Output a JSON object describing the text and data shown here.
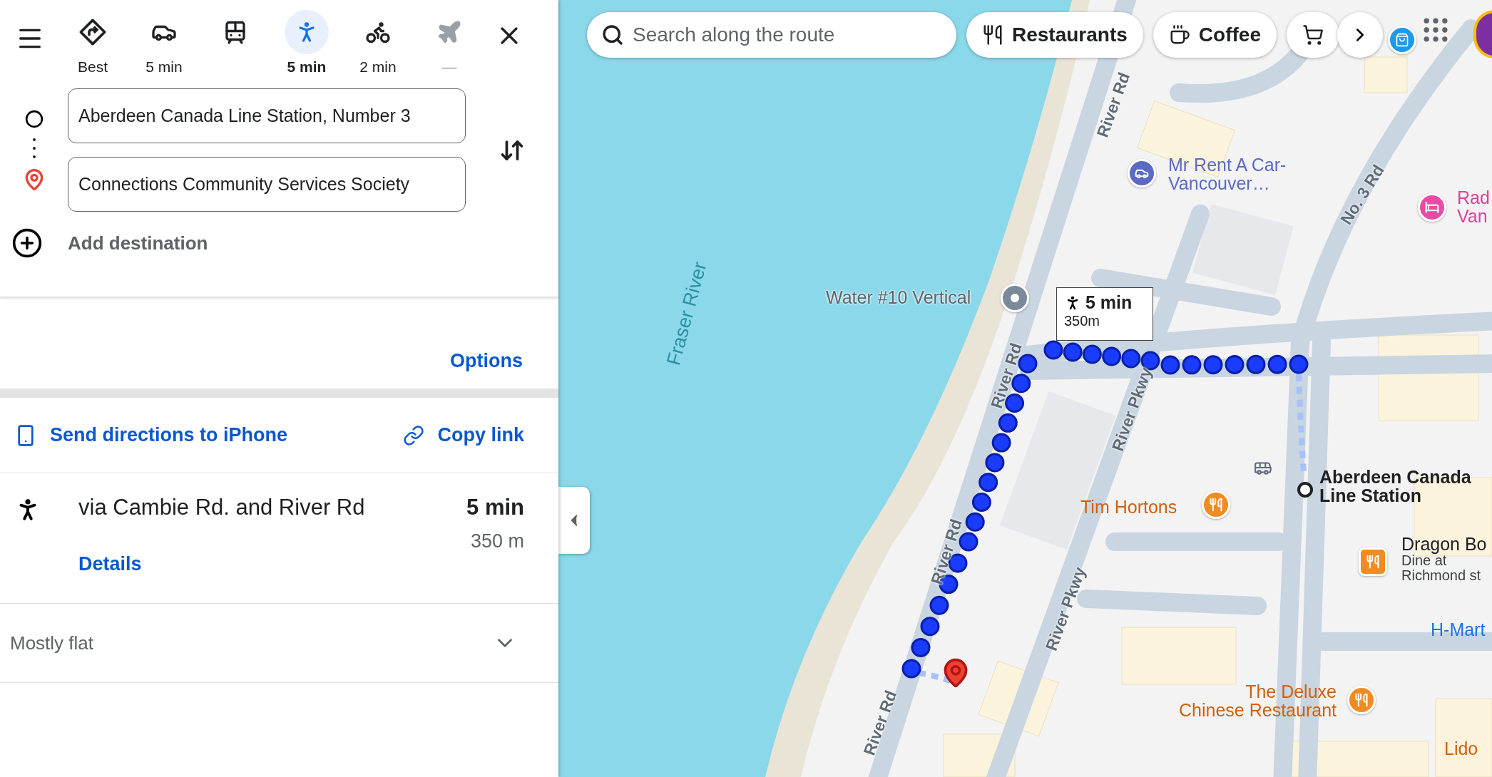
{
  "travel_modes": [
    {
      "kind": "best",
      "label": "Best",
      "selected": false,
      "disabled": false
    },
    {
      "kind": "car",
      "label": "5 min",
      "selected": false,
      "disabled": false
    },
    {
      "kind": "transit",
      "selected": false,
      "disabled": false
    },
    {
      "kind": "walk",
      "label": "5 min",
      "selected": true,
      "disabled": false
    },
    {
      "kind": "bike",
      "label": "2 min",
      "selected": false,
      "disabled": false
    },
    {
      "kind": "flight",
      "label": "—",
      "selected": false,
      "disabled": true
    }
  ],
  "origin": {
    "value": "Aberdeen Canada Line Station, Number 3"
  },
  "destination": {
    "value": "Connections Community Services Society"
  },
  "add_destination": "Add destination",
  "options_link": "Options",
  "actions": [
    {
      "kind": "send",
      "label": "Send directions to iPhone"
    },
    {
      "kind": "link",
      "label": "Copy link"
    }
  ],
  "route": {
    "title": "via Cambie Rd. and River Rd",
    "duration": "5 min",
    "distance": "350 m",
    "details_link": "Details"
  },
  "elevation": {
    "label": "Mostly flat",
    "expanded": false
  },
  "map": {
    "search": {
      "placeholder": "Search along the route"
    },
    "chips": [
      {
        "kind": "restaurant",
        "label": "Restaurants"
      },
      {
        "kind": "coffee",
        "label": "Coffee"
      },
      {
        "kind": "cart"
      }
    ],
    "route_callout": {
      "duration": "5 min",
      "distance": "350m"
    },
    "labels": [
      {
        "kind": "road",
        "lines": [
          "River Rd"
        ]
      },
      {
        "kind": "car-rental",
        "lines": [
          "Mr Rent A Car-",
          "Vancouver…"
        ]
      },
      {
        "kind": "road",
        "lines": [
          "No. 3 Rd"
        ]
      },
      {
        "kind": "hotel",
        "lines": [
          "Rad",
          "Van"
        ]
      },
      {
        "kind": "water",
        "lines": [
          "Fraser River"
        ]
      },
      {
        "kind": "landmark",
        "lines": [
          "Water #10 Vertical"
        ]
      },
      {
        "kind": "road",
        "lines": [
          "River Rd"
        ]
      },
      {
        "kind": "road",
        "lines": [
          "River Pkwy"
        ]
      },
      {
        "kind": "station",
        "lines": [
          "Aberdeen Canada",
          "Line Station"
        ]
      },
      {
        "kind": "restaurant",
        "lines": [
          "Tim Hortons"
        ]
      },
      {
        "kind": "road",
        "lines": [
          "River Rd"
        ]
      },
      {
        "kind": "venue",
        "lines": [
          "Dragon Bo"
        ],
        "notes": [
          "Dine at",
          "Richmond st"
        ]
      },
      {
        "kind": "shop",
        "lines": [
          "H-Mart"
        ]
      },
      {
        "kind": "road",
        "lines": [
          "River Pkwy"
        ]
      },
      {
        "kind": "restaurant",
        "lines": [
          "The Deluxe",
          "Chinese Restaurant"
        ]
      },
      {
        "kind": "road",
        "lines": [
          "River Rd"
        ]
      },
      {
        "kind": "restaurant",
        "lines": [
          "Lido"
        ]
      }
    ]
  }
}
